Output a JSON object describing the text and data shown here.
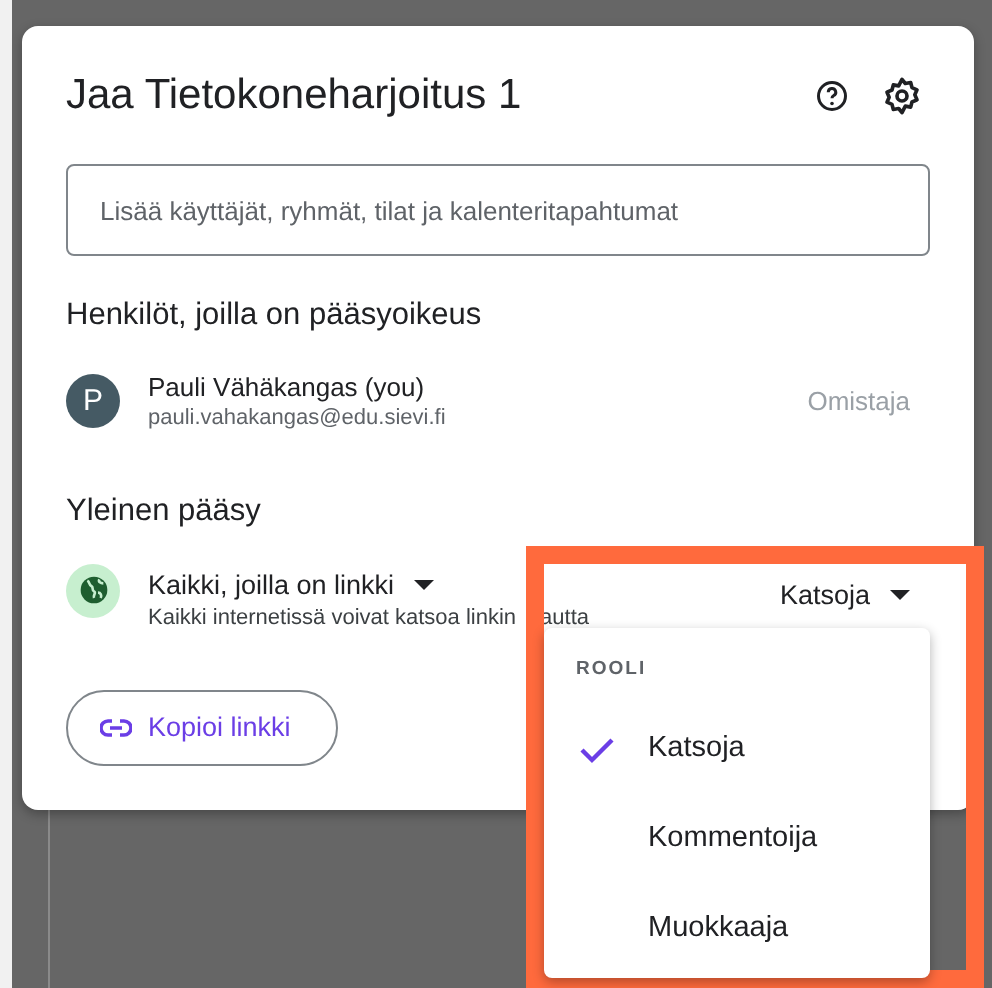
{
  "dialog": {
    "title": "Jaa Tietokoneharjoitus 1",
    "search": {
      "placeholder": "Lisää käyttäjät, ryhmät, tilat ja kalenteritapahtumat"
    },
    "people_heading": "Henkilöt, joilla on pääsyoikeus",
    "people": [
      {
        "initial": "P",
        "name": "Pauli Vähäkangas (you)",
        "email": "pauli.vahakangas@edu.sievi.fi",
        "role": "Omistaja"
      }
    ],
    "access_heading": "Yleinen pääsy",
    "access": {
      "label": "Kaikki, joilla on linkki",
      "description": "Kaikki internetissä voivat katsoa linkin",
      "description_tail": "autta",
      "role": "Katsoja"
    },
    "copy_button": "Kopioi linkki"
  },
  "role_menu": {
    "heading": "ROOLI",
    "items": [
      {
        "label": "Katsoja",
        "selected": true
      },
      {
        "label": "Kommentoija",
        "selected": false
      },
      {
        "label": "Muokkaaja",
        "selected": false
      }
    ]
  }
}
